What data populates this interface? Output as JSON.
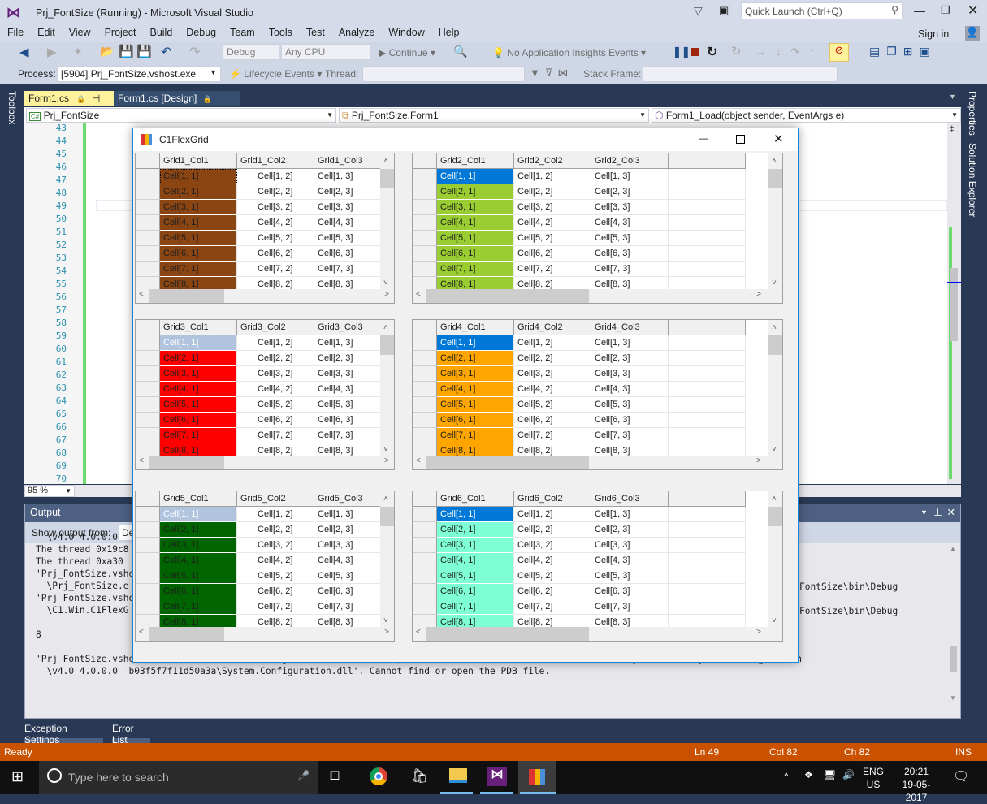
{
  "window": {
    "title": "Prj_FontSize (Running) - Microsoft Visual Studio",
    "quick_launch_placeholder": "Quick Launch (Ctrl+Q)",
    "sign_in": "Sign in"
  },
  "menu": [
    "File",
    "Edit",
    "View",
    "Project",
    "Build",
    "Debug",
    "Team",
    "Tools",
    "Test",
    "Analyze",
    "Window",
    "Help"
  ],
  "toolbar": {
    "config": "Debug",
    "platform": "Any CPU",
    "continue": "Continue",
    "insights": "No Application Insights Events",
    "process_label": "Process:",
    "process_value": "[5904] Prj_FontSize.vshost.exe",
    "lifecycle": "Lifecycle Events",
    "thread_label": "Thread:",
    "stack_frame_label": "Stack Frame:"
  },
  "tabs": [
    {
      "label": "Form1.cs",
      "active": true
    },
    {
      "label": "Form1.cs [Design]",
      "active": false
    }
  ],
  "side_left": "Toolbox",
  "side_right": [
    "Properties",
    "Solution Explorer"
  ],
  "nav": {
    "project": "Prj_FontSize",
    "class": "Prj_FontSize.Form1",
    "member": "Form1_Load(object sender, EventArgs e)"
  },
  "editor": {
    "line_numbers": [
      "43",
      "44",
      "45",
      "46",
      "47",
      "48",
      "49",
      "50",
      "51",
      "52",
      "53",
      "54",
      "55",
      "56",
      "57",
      "58",
      "59",
      "60",
      "61",
      "62",
      "63",
      "64",
      "65",
      "66",
      "67",
      "68",
      "69",
      "70"
    ],
    "zoom": "95 %"
  },
  "output": {
    "title": "Output",
    "show_from_label": "Show output from:",
    "source": "De",
    "lines": [
      "  \\v4.0_4.0.0.0__",
      "The thread 0x19c8",
      "The thread 0xa30",
      "'Prj_FontSize.vshost",
      "  \\Prj_FontSize.e",
      "'Prj_FontSize.vshost",
      "  \\C1.Win.C1FlexG",
      "",
      "8",
      "",
      "'Prj_FontSize.vshost.exe' (CLR v4.0.30319: Prj_FontSize.vshost.exe): Loaded 'C:\\WINDOWS\\Microsoft.Net\\assembly\\GAC_MSIL\\System.Configuration",
      "  \\v4.0_4.0.0.0__b03f5f7f11d50a3a\\System.Configuration.dll'. Cannot find or open the PDB file."
    ],
    "right_fragments": [
      "FontSize\\bin\\Debug",
      "FontSize\\bin\\Debug"
    ]
  },
  "bottom_tabs": [
    "Exception Settings",
    "Error List"
  ],
  "status": {
    "text": "Ready",
    "ln": "Ln 49",
    "col": "Col 82",
    "ch": "Ch 82",
    "mode": "INS"
  },
  "taskbar": {
    "search_placeholder": "Type here to search",
    "lang1": "ENG",
    "lang2": "US",
    "time": "20:21",
    "date": "19-05-2017"
  },
  "form": {
    "title": "C1FlexGrid",
    "cells": [
      [
        "Cell[1, 1]",
        "Cell[1, 2]",
        "Cell[1, 3]"
      ],
      [
        "Cell[2, 1]",
        "Cell[2, 2]",
        "Cell[2, 3]"
      ],
      [
        "Cell[3, 1]",
        "Cell[3, 2]",
        "Cell[3, 3]"
      ],
      [
        "Cell[4, 1]",
        "Cell[4, 2]",
        "Cell[4, 3]"
      ],
      [
        "Cell[5, 1]",
        "Cell[5, 2]",
        "Cell[5, 3]"
      ],
      [
        "Cell[6, 1]",
        "Cell[6, 2]",
        "Cell[6, 3]"
      ],
      [
        "Cell[7, 1]",
        "Cell[7, 2]",
        "Cell[7, 3]"
      ],
      [
        "Cell[8, 1]",
        "Cell[8, 2]",
        "Cell[8, 3]"
      ]
    ],
    "grids": [
      {
        "headers": [
          "Grid1_Col1",
          "Grid1_Col2",
          "Grid1_Col3"
        ],
        "col1_color": "#8b4513",
        "first_cell_color": "#8b4513",
        "first_cell_text_color": "#1e1e1e",
        "col1_text_color": "#1e1e1e"
      },
      {
        "headers": [
          "Grid2_Col1",
          "Grid2_Col2",
          "Grid2_Col3"
        ],
        "col1_color": "#9acd32",
        "first_cell_color": "#0078d7",
        "first_cell_text_color": "#ffffff",
        "col1_text_color": "#1e1e1e"
      },
      {
        "headers": [
          "Grid3_Col1",
          "Grid3_Col2",
          "Grid3_Col3"
        ],
        "col1_color": "#ff0000",
        "first_cell_color": "#b0c4de",
        "first_cell_text_color": "#ffffff",
        "col1_text_color": "#1e1e1e"
      },
      {
        "headers": [
          "Grid4_Col1",
          "Grid4_Col2",
          "Grid4_Col3"
        ],
        "col1_color": "#ffa500",
        "first_cell_color": "#0078d7",
        "first_cell_text_color": "#ffffff",
        "col1_text_color": "#1e1e1e"
      },
      {
        "headers": [
          "Grid5_Col1",
          "Grid5_Col2",
          "Grid5_Col3"
        ],
        "col1_color": "#006400",
        "first_cell_color": "#b0c4de",
        "first_cell_text_color": "#ffffff",
        "col1_text_color": "#1e1e1e"
      },
      {
        "headers": [
          "Grid6_Col1",
          "Grid6_Col2",
          "Grid6_Col3"
        ],
        "col1_color": "#7fffd4",
        "first_cell_color": "#0078d7",
        "first_cell_text_color": "#ffffff",
        "col1_text_color": "#1e1e1e"
      }
    ]
  },
  "colors": {
    "status_bar": "#ca5100",
    "ide_dark": "#293955",
    "active_tab": "#fff29d",
    "form_border": "#1883d7"
  }
}
